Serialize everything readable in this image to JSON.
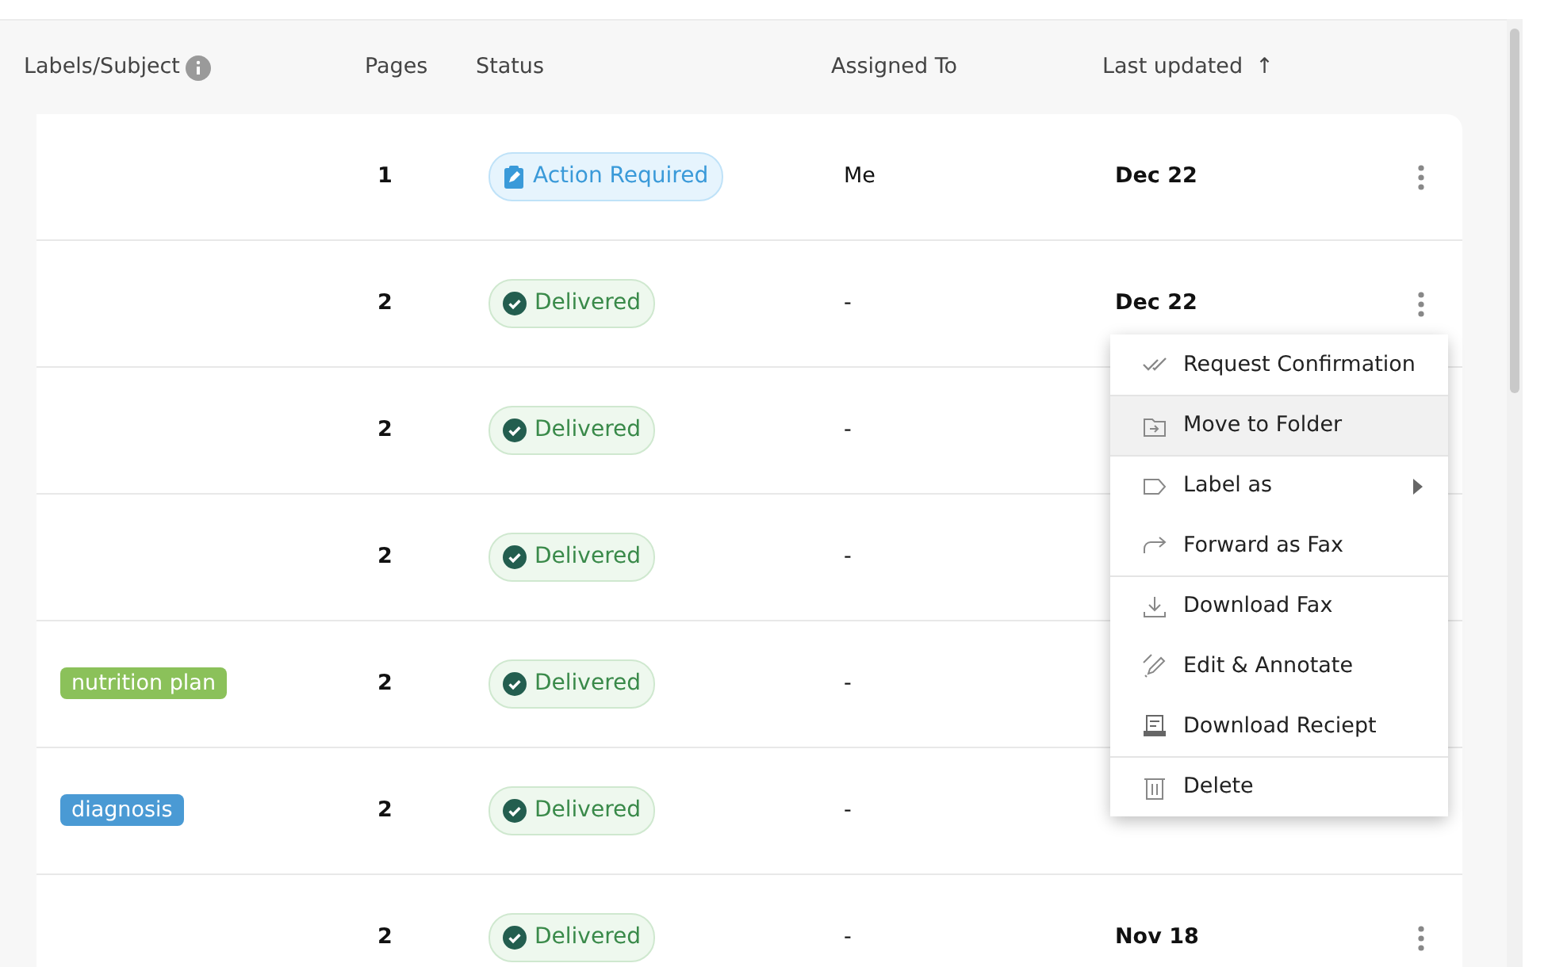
{
  "table": {
    "columns": [
      {
        "label": "Labels/Subject",
        "info": true
      },
      {
        "label": "Pages"
      },
      {
        "label": "Status"
      },
      {
        "label": "Assigned To"
      },
      {
        "label": "Last updated",
        "sort_glyph": "↑"
      }
    ],
    "rows": [
      {
        "pages": "1",
        "status": {
          "kind": "action",
          "label": "Action Required"
        },
        "assigned": "Me",
        "date": "Dec 22"
      },
      {
        "pages": "2",
        "status": {
          "kind": "delivered",
          "label": "Delivered"
        },
        "assigned": "-",
        "date": "Dec 22"
      },
      {
        "pages": "2",
        "status": {
          "kind": "delivered",
          "label": "Delivered"
        },
        "assigned": "-"
      },
      {
        "pages": "2",
        "status": {
          "kind": "delivered",
          "label": "Delivered"
        },
        "assigned": "-"
      },
      {
        "label": {
          "text": "nutrition plan",
          "color": "#8bc15a"
        },
        "pages": "2",
        "status": {
          "kind": "delivered",
          "label": "Delivered"
        },
        "assigned": "-"
      },
      {
        "label": {
          "text": "diagnosis",
          "color": "#4a9ad4"
        },
        "pages": "2",
        "status": {
          "kind": "delivered",
          "label": "Delivered"
        },
        "assigned": "-"
      },
      {
        "pages": "2",
        "status": {
          "kind": "delivered",
          "label": "Delivered"
        },
        "assigned": "-",
        "date": "Nov 18"
      }
    ]
  },
  "context_menu": {
    "items": [
      {
        "label": "Request Confirmation",
        "selected": false
      },
      {
        "label": "Move to Folder",
        "selected": true,
        "divider_before": true
      },
      {
        "label": "Label as",
        "selected": false,
        "submenu": true,
        "divider_before": true
      },
      {
        "label": "Forward as Fax",
        "selected": false
      },
      {
        "label": "Download Fax",
        "selected": false,
        "divider_before": true
      },
      {
        "label": "Edit & Annotate",
        "selected": false
      },
      {
        "label": "Download Reciept",
        "selected": false
      },
      {
        "label": "Delete",
        "selected": false,
        "divider_before": true
      }
    ]
  }
}
